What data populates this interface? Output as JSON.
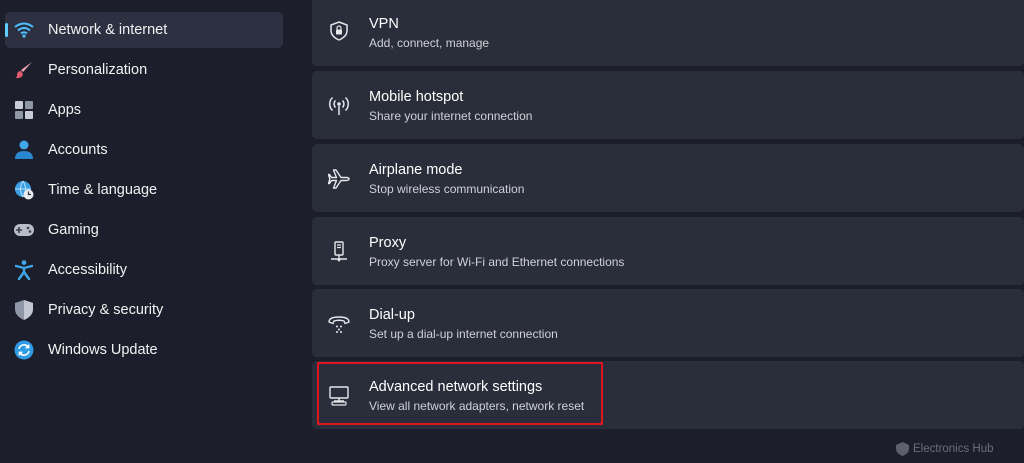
{
  "sidebar": {
    "items": [
      {
        "label": "Network & internet",
        "icon": "wifi-icon",
        "selected": true
      },
      {
        "label": "Personalization",
        "icon": "brush-icon"
      },
      {
        "label": "Apps",
        "icon": "apps-icon"
      },
      {
        "label": "Accounts",
        "icon": "person-icon"
      },
      {
        "label": "Time & language",
        "icon": "globe-clock-icon"
      },
      {
        "label": "Gaming",
        "icon": "gamepad-icon"
      },
      {
        "label": "Accessibility",
        "icon": "accessibility-icon"
      },
      {
        "label": "Privacy & security",
        "icon": "shield-icon"
      },
      {
        "label": "Windows Update",
        "icon": "update-icon"
      }
    ]
  },
  "settings": [
    {
      "title": "VPN",
      "subtitle": "Add, connect, manage",
      "icon": "vpn-shield-icon"
    },
    {
      "title": "Mobile hotspot",
      "subtitle": "Share your internet connection",
      "icon": "hotspot-icon"
    },
    {
      "title": "Airplane mode",
      "subtitle": "Stop wireless communication",
      "icon": "airplane-icon"
    },
    {
      "title": "Proxy",
      "subtitle": "Proxy server for Wi-Fi and Ethernet connections",
      "icon": "proxy-icon"
    },
    {
      "title": "Dial-up",
      "subtitle": "Set up a dial-up internet connection",
      "icon": "dialup-icon"
    },
    {
      "title": "Advanced network settings",
      "subtitle": "View all network adapters, network reset",
      "icon": "monitor-network-icon",
      "highlighted": true
    }
  ],
  "watermark": {
    "text": "Electronics Hub"
  },
  "colors": {
    "background": "#1c1f2b",
    "card": "#2a2d3a",
    "accent": "#60cdff",
    "highlight": "#e0141e"
  }
}
